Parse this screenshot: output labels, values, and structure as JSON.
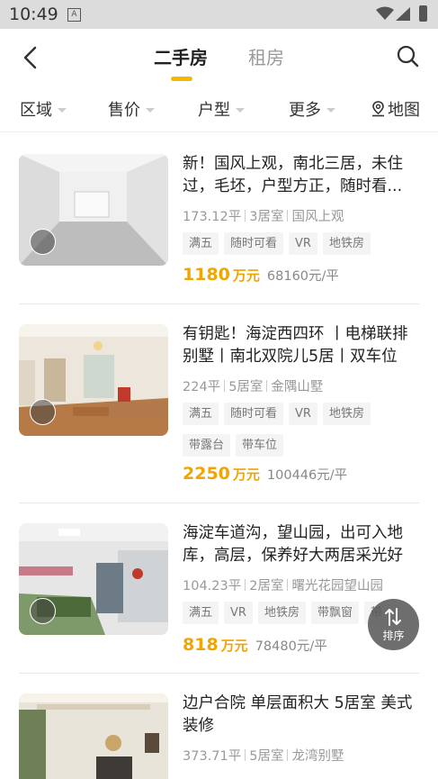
{
  "status_bar": {
    "time": "10:49",
    "notif_icon": "A"
  },
  "nav": {
    "tabs": [
      {
        "label": "二手房",
        "active": true
      },
      {
        "label": "租房",
        "active": false
      }
    ],
    "accent": "#f5b800"
  },
  "filters": [
    {
      "label": "区域"
    },
    {
      "label": "售价"
    },
    {
      "label": "户型"
    },
    {
      "label": "更多"
    }
  ],
  "map_label": "地图",
  "listings": [
    {
      "title_line1": "新！国风上观，南北三居，未住",
      "title_line2": "过，毛坯，户型方正，随时看...",
      "area": "173.12平",
      "rooms": "3居室",
      "community": "国风上观",
      "tags": [
        "满五",
        "随时可看",
        "VR",
        "地铁房"
      ],
      "price": "1180",
      "price_unit": "万元",
      "unit_price": "68160元/平"
    },
    {
      "title_line1": "有钥匙！海淀西四环 丨电梯联排",
      "title_line2": "别墅丨南北双院儿5居丨双车位",
      "area": "224平",
      "rooms": "5居室",
      "community": "金隅山墅",
      "tags": [
        "满五",
        "随时可看",
        "VR",
        "地铁房",
        "带露台",
        "带车位"
      ],
      "price": "2250",
      "price_unit": "万元",
      "unit_price": "100446元/平"
    },
    {
      "title_line1": "海淀车道沟，望山园，出可入地",
      "title_line2": "库，高层，保养好大两居采光好",
      "area": "104.23平",
      "rooms": "2居室",
      "community": "曙光花园望山园",
      "tags": [
        "满五",
        "VR",
        "地铁房",
        "带飘窗",
        "带"
      ],
      "price": "818",
      "price_unit": "万元",
      "unit_price": "78480元/平"
    },
    {
      "title_line1": "边户合院 单层面积大 5居室 美式",
      "title_line2": "装修",
      "area": "373.71平",
      "rooms": "5居室",
      "community": "龙湾别墅",
      "tags": [],
      "price": "",
      "price_unit": "",
      "unit_price": ""
    }
  ],
  "sort_button_label": "排序",
  "colors": {
    "price": "#f0a500",
    "accent": "#f5b800"
  }
}
